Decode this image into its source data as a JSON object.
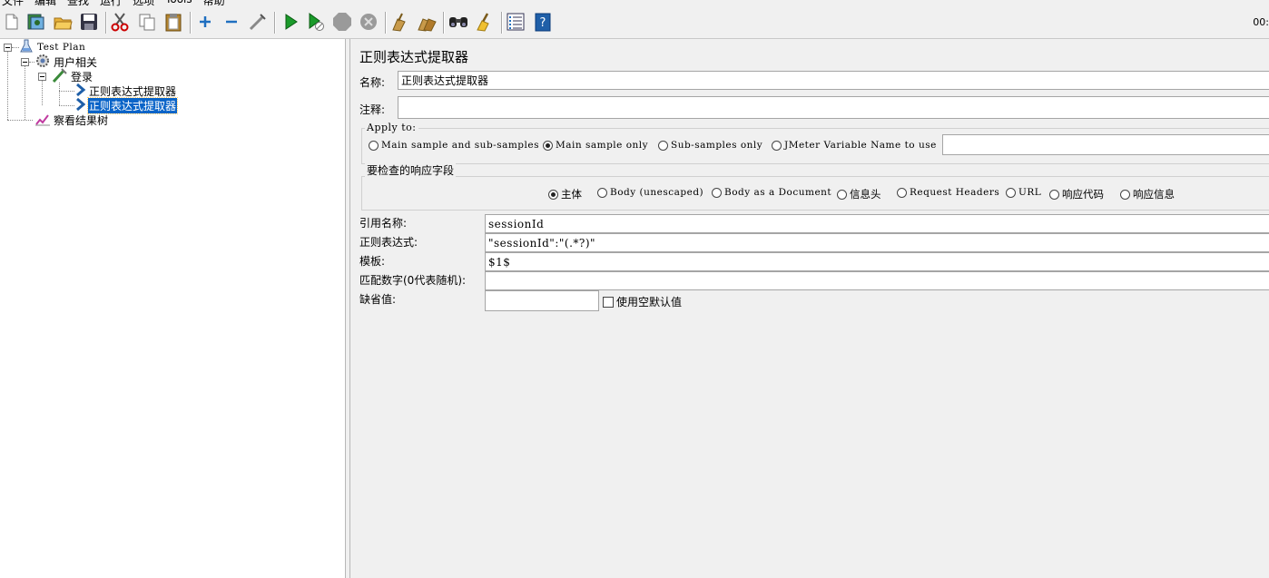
{
  "menubar": {
    "items": [
      "文件",
      "编辑",
      "查找",
      "运行",
      "选项",
      "Tools",
      "帮助"
    ]
  },
  "toolbar": {
    "buttons": [
      "new-icon",
      "templates-icon",
      "open-icon",
      "save-icon",
      "cut-icon",
      "copy-icon",
      "paste-icon",
      "expand-icon",
      "collapse-icon",
      "toggle-icon",
      "start-icon",
      "start-no-timers-icon",
      "stop-icon",
      "shutdown-icon",
      "clear-icon",
      "clear-all-icon",
      "search-icon",
      "reset-search-icon",
      "function-helper-icon",
      "help-icon"
    ],
    "timer": "00:"
  },
  "tree": {
    "items": [
      {
        "label": "Test Plan",
        "icon": "test-plan-icon"
      },
      {
        "label": "用户相关",
        "icon": "thread-group-icon"
      },
      {
        "label": "登录",
        "icon": "sampler-icon"
      },
      {
        "label": "正则表达式提取器",
        "icon": "extractor-icon"
      },
      {
        "label": "正则表达式提取器",
        "icon": "extractor-icon",
        "selected": true
      },
      {
        "label": "察看结果树",
        "icon": "listener-icon"
      }
    ]
  },
  "panel": {
    "title": "正则表达式提取器",
    "name_label": "名称:",
    "name_value": "正则表达式提取器",
    "comment_label": "注释:",
    "comment_value": "",
    "apply_to": {
      "legend": "Apply to:",
      "options": [
        "Main sample and sub-samples",
        "Main sample only",
        "Sub-samples only",
        "JMeter Variable Name to use"
      ],
      "selected": "Main sample only",
      "variable_value": ""
    },
    "field_to_check": {
      "legend": "要检查的响应字段",
      "options": [
        "主体",
        "Body (unescaped)",
        "Body as a Document",
        "信息头",
        "Request Headers",
        "URL",
        "响应代码",
        "响应信息"
      ],
      "selected": "主体"
    },
    "ref_name_label": "引用名称:",
    "ref_name_value": "sessionId",
    "regex_label": "正则表达式:",
    "regex_value": "\"sessionId\":\"(.*?)\"",
    "template_label": "模板:",
    "template_value": "$1$",
    "match_no_label": "匹配数字(0代表随机):",
    "match_no_value": "",
    "default_label": "缺省值:",
    "default_value": "",
    "use_empty_label": "使用空默认值"
  }
}
